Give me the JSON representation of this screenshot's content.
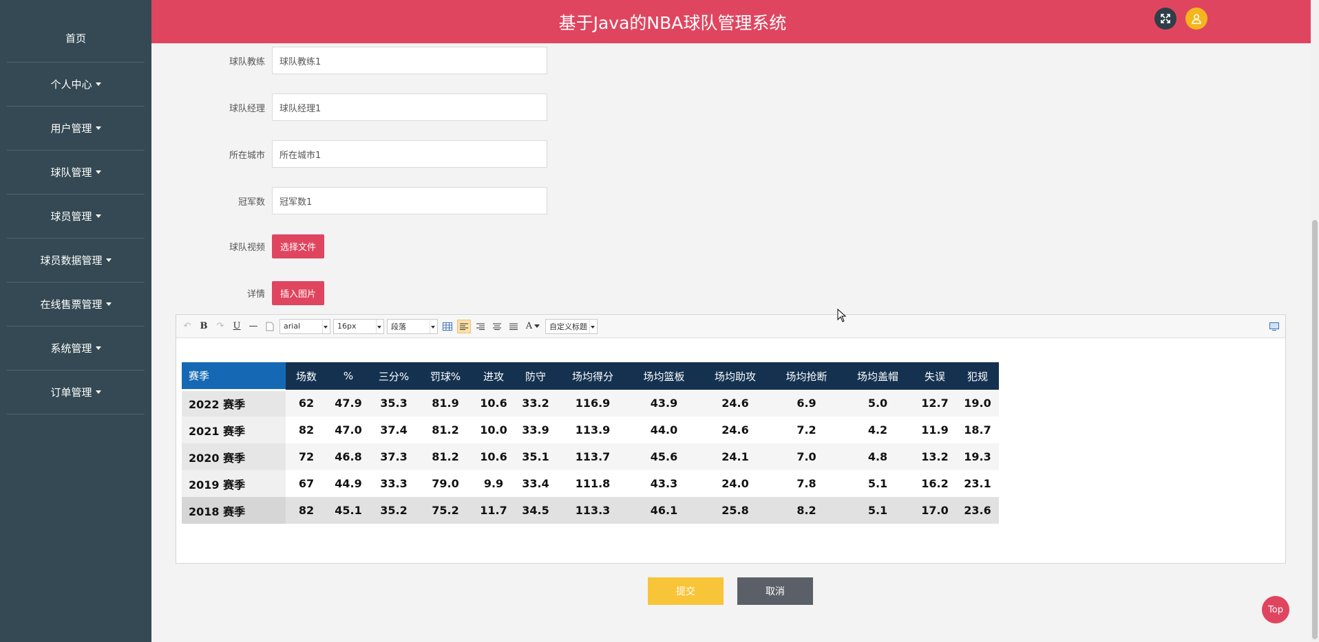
{
  "app": {
    "title": "基于Java的NBA球队管理系统"
  },
  "sidebar": {
    "items": [
      {
        "label": "首页",
        "dropdown": false
      },
      {
        "label": "个人中心",
        "dropdown": true
      },
      {
        "label": "用户管理",
        "dropdown": true
      },
      {
        "label": "球队管理",
        "dropdown": true
      },
      {
        "label": "球员管理",
        "dropdown": true
      },
      {
        "label": "球员数据管理",
        "dropdown": true
      },
      {
        "label": "在线售票管理",
        "dropdown": true
      },
      {
        "label": "系统管理",
        "dropdown": true
      },
      {
        "label": "订单管理",
        "dropdown": true
      }
    ]
  },
  "header": {
    "expand_icon": "expand-icon",
    "user_icon": "user-icon"
  },
  "form": {
    "coach": {
      "label": "球队教练",
      "value": "球队教练1"
    },
    "manager": {
      "label": "球队经理",
      "value": "球队经理1"
    },
    "city": {
      "label": "所在城市",
      "value": "所在城市1"
    },
    "titles": {
      "label": "冠军数",
      "value": "冠军数1"
    },
    "video": {
      "label": "球队视频",
      "button": "选择文件"
    },
    "detail": {
      "label": "详情",
      "button": "插入图片"
    }
  },
  "editor": {
    "toolbar": {
      "undo_icon": "↶",
      "bold": "B",
      "redo_icon": "↷",
      "underline": "U",
      "hr": "—",
      "font_family": "arial",
      "font_size": "16px",
      "paragraph": "段落",
      "font_color": "A",
      "custom_heading": "自定义标题"
    },
    "table": {
      "headers": [
        "赛季",
        "场数",
        "%",
        "三分%",
        "罚球%",
        "进攻",
        "防守",
        "场均得分",
        "场均篮板",
        "场均助攻",
        "场均抢断",
        "场均盖帽",
        "失误",
        "犯规"
      ],
      "rows": [
        [
          "2022 赛季",
          "62",
          "47.9",
          "35.3",
          "81.9",
          "10.6",
          "33.2",
          "116.9",
          "43.9",
          "24.6",
          "6.9",
          "5.0",
          "12.7",
          "19.0"
        ],
        [
          "2021 赛季",
          "82",
          "47.0",
          "37.4",
          "81.2",
          "10.0",
          "33.9",
          "113.9",
          "44.0",
          "24.6",
          "7.2",
          "4.2",
          "11.9",
          "18.7"
        ],
        [
          "2020 赛季",
          "72",
          "46.8",
          "37.3",
          "81.2",
          "10.6",
          "35.1",
          "113.7",
          "45.6",
          "24.1",
          "7.0",
          "4.8",
          "13.2",
          "19.3"
        ],
        [
          "2019 赛季",
          "67",
          "44.9",
          "33.3",
          "79.0",
          "9.9",
          "33.4",
          "111.8",
          "43.3",
          "24.0",
          "7.8",
          "5.1",
          "16.2",
          "23.1"
        ],
        [
          "2018 赛季",
          "82",
          "45.1",
          "35.2",
          "75.2",
          "11.7",
          "34.5",
          "113.3",
          "46.1",
          "25.8",
          "8.2",
          "5.1",
          "17.0",
          "23.6"
        ]
      ]
    }
  },
  "actions": {
    "submit": "提交",
    "cancel": "取消",
    "top": "Top"
  },
  "colors": {
    "primary": "#e0455f",
    "sidebar": "#344953",
    "submit": "#f8c438",
    "cancel": "#5b6068"
  }
}
